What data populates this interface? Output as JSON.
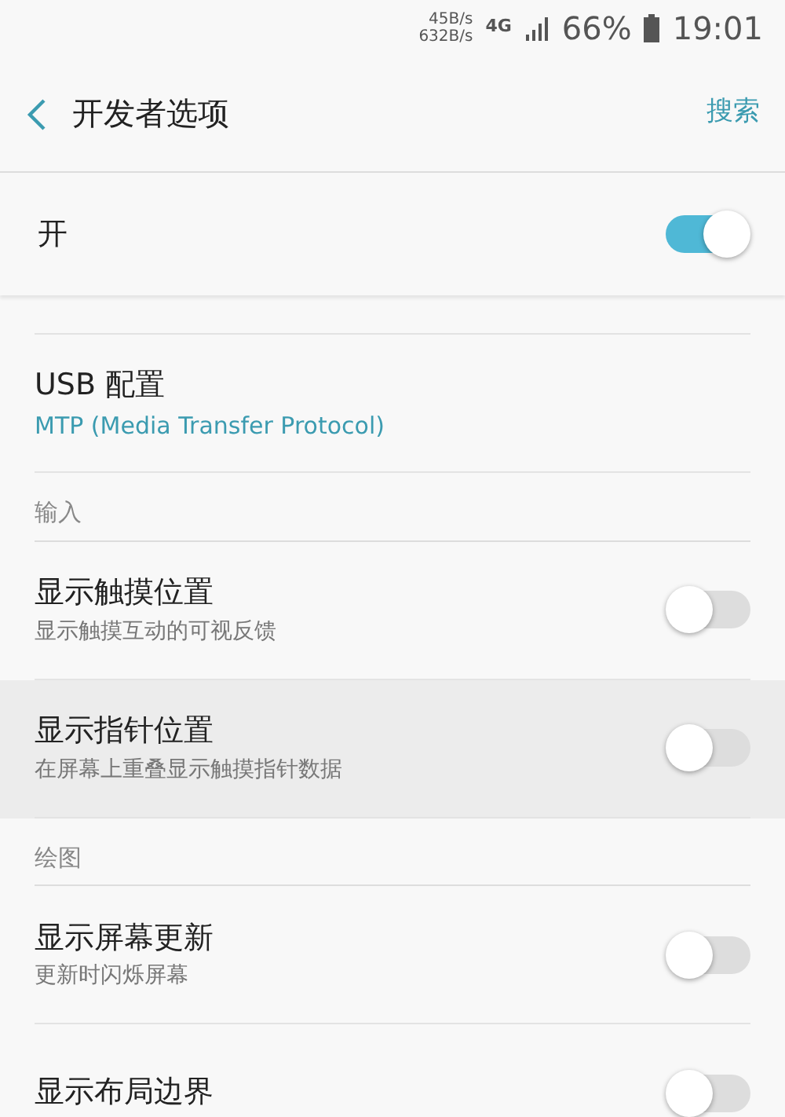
{
  "status_bar": {
    "speed_up": "45B/s",
    "speed_down": "632B/s",
    "network": "4G",
    "battery": "66%",
    "time": "19:01"
  },
  "header": {
    "title": "开发者选项",
    "action": "搜索"
  },
  "master": {
    "label": "开",
    "on": true
  },
  "items": [
    {
      "kind": "link",
      "title": "USB 配置",
      "subtitle": "MTP (Media Transfer Protocol)"
    },
    {
      "kind": "section",
      "title": "输入"
    },
    {
      "kind": "toggle",
      "title": "显示触摸位置",
      "subtitle": "显示触摸互动的可视反馈",
      "on": false,
      "selected": false
    },
    {
      "kind": "toggle",
      "title": "显示指针位置",
      "subtitle": "在屏幕上重叠显示触摸指针数据",
      "on": false,
      "selected": true
    },
    {
      "kind": "section",
      "title": "绘图"
    },
    {
      "kind": "toggle",
      "title": "显示屏幕更新",
      "subtitle": "更新时闪烁屏幕",
      "on": false,
      "selected": false
    },
    {
      "kind": "toggle",
      "title": "显示布局边界",
      "on": false,
      "selected": false
    }
  ]
}
